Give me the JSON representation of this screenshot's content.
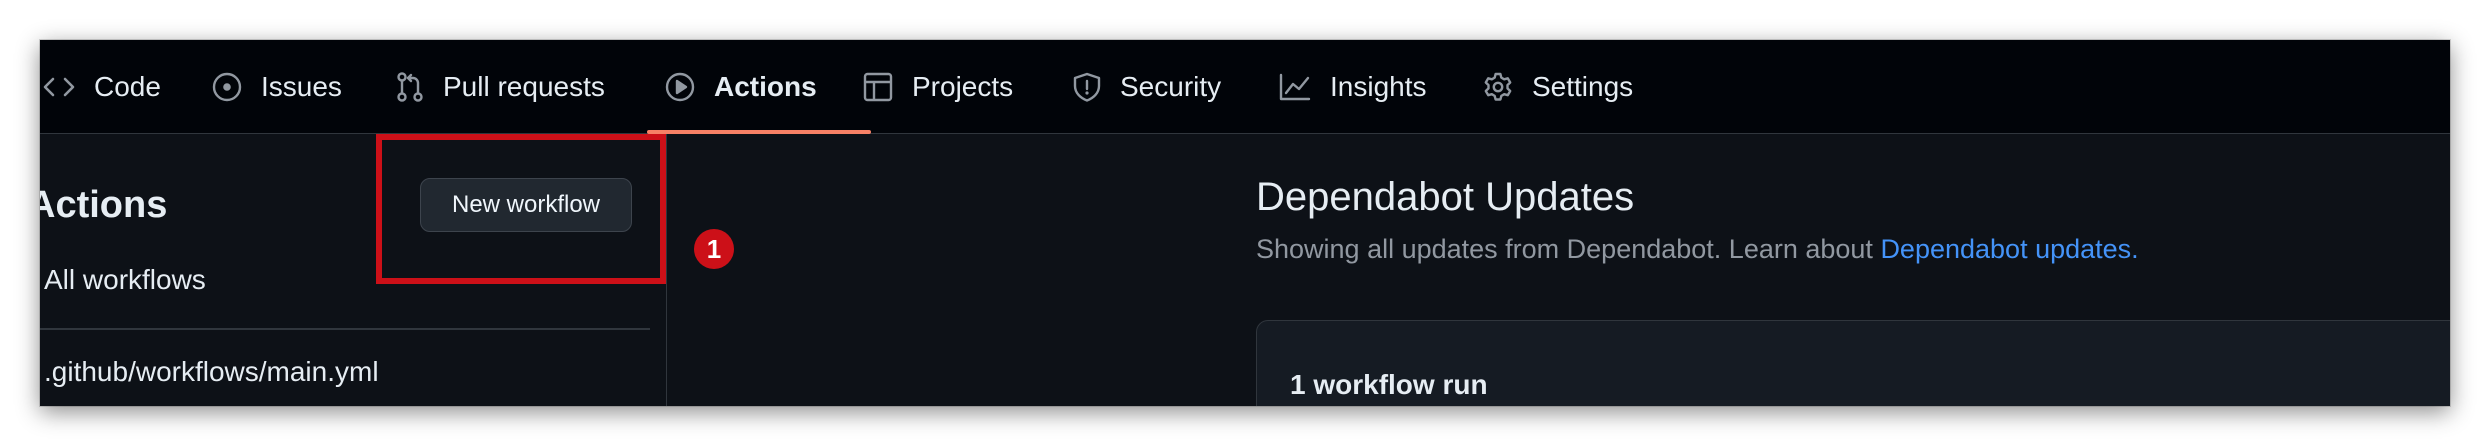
{
  "nav": {
    "items": [
      {
        "label": "Code",
        "icon": "code-icon"
      },
      {
        "label": "Issues",
        "icon": "issue-opened-icon"
      },
      {
        "label": "Pull requests",
        "icon": "git-pull-request-icon"
      },
      {
        "label": "Actions",
        "icon": "play-icon",
        "active": true
      },
      {
        "label": "Projects",
        "icon": "table-icon"
      },
      {
        "label": "Security",
        "icon": "shield-icon"
      },
      {
        "label": "Insights",
        "icon": "graph-icon"
      },
      {
        "label": "Settings",
        "icon": "gear-icon"
      }
    ]
  },
  "sidebar": {
    "title": "Actions",
    "new_workflow_label": "New workflow",
    "all_workflows_label": "All workflows",
    "workflow_file": ".github/workflows/main.yml"
  },
  "annotation": {
    "step_number": "1",
    "color": "#cc1018"
  },
  "main": {
    "title": "Dependabot Updates",
    "subtitle_text": "Showing all updates from Dependabot. Learn about ",
    "subtitle_link": "Dependabot updates.",
    "runs_count_label": "1 workflow run"
  },
  "colors": {
    "background": "#0d1117",
    "nav_background": "#010409",
    "accent_underline": "#f78166",
    "link": "#4493f8",
    "text": "#e6edf3",
    "muted_text": "#9198a1"
  }
}
